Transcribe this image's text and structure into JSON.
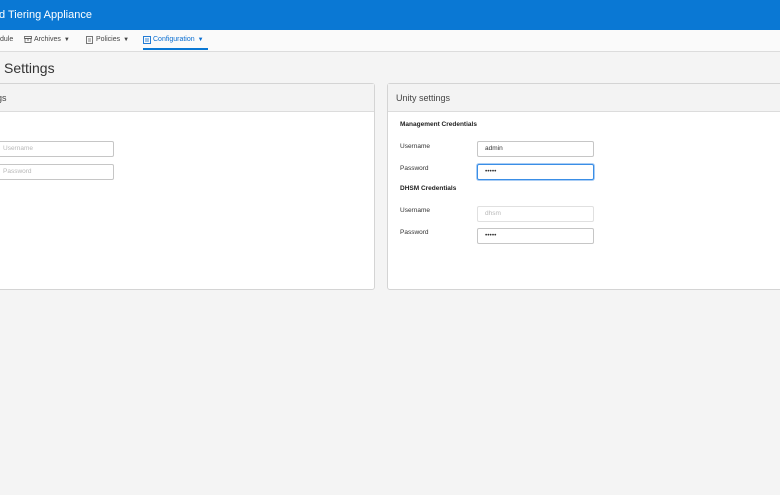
{
  "header": {
    "title": "d Tiering Appliance"
  },
  "nav": {
    "items": [
      {
        "label": "dule"
      },
      {
        "label": "Archives",
        "icon": "archive-icon"
      },
      {
        "label": "Policies",
        "icon": "policy-document-icon"
      },
      {
        "label": "Configuration",
        "icon": "configuration-icon",
        "active": true
      }
    ]
  },
  "page": {
    "title": "Settings"
  },
  "left_card": {
    "title": "gs",
    "username_placeholder": "Username",
    "password_placeholder": "Password"
  },
  "unity_card": {
    "title": "Unity settings",
    "management": {
      "heading": "Management Credentials",
      "username_label": "Username",
      "username_value": "admin",
      "password_label": "Password",
      "password_value": "•••••"
    },
    "dhsm": {
      "heading": "DHSM Credentials",
      "username_label": "Username",
      "username_placeholder": "dhsm",
      "password_label": "Password",
      "password_value": "•••••"
    }
  },
  "colors": {
    "brand": "#0a78d4",
    "focus": "#3a8ee6"
  }
}
